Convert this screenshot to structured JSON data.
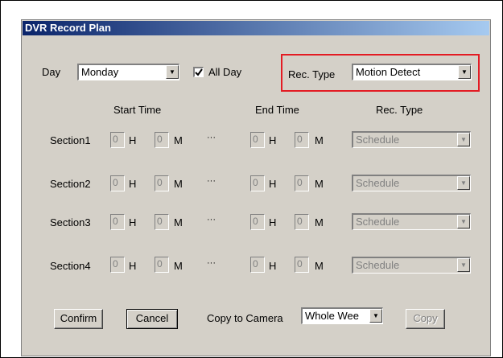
{
  "window": {
    "title": "DVR Record Plan"
  },
  "day": {
    "label": "Day",
    "value": "Monday"
  },
  "all_day": {
    "label": "All Day",
    "checked": true
  },
  "rec_type": {
    "label": "Rec. Type",
    "value": "Motion Detect"
  },
  "columns": {
    "start": "Start Time",
    "end": "End Time",
    "rec_type": "Rec. Type"
  },
  "units": {
    "hour": "H",
    "minute": "M",
    "separator": "···"
  },
  "sections": [
    {
      "label": "Section1",
      "start_h": "0",
      "start_m": "0",
      "end_h": "0",
      "end_m": "0",
      "type": "Schedule"
    },
    {
      "label": "Section2",
      "start_h": "0",
      "start_m": "0",
      "end_h": "0",
      "end_m": "0",
      "type": "Schedule"
    },
    {
      "label": "Section3",
      "start_h": "0",
      "start_m": "0",
      "end_h": "0",
      "end_m": "0",
      "type": "Schedule"
    },
    {
      "label": "Section4",
      "start_h": "0",
      "start_m": "0",
      "end_h": "0",
      "end_m": "0",
      "type": "Schedule"
    }
  ],
  "buttons": {
    "confirm": "Confirm",
    "cancel": "Cancel",
    "copy": "Copy"
  },
  "copy_to_camera": {
    "label": "Copy to Camera",
    "value": "Whole Wee"
  },
  "colors": {
    "highlight": "#e31b23",
    "title_start": "#0a246a",
    "title_end": "#a6caf0",
    "dialog_bg": "#d4d0c8"
  },
  "icons": {
    "dropdown": "chevron-down-icon",
    "check": "checkmark-icon"
  }
}
